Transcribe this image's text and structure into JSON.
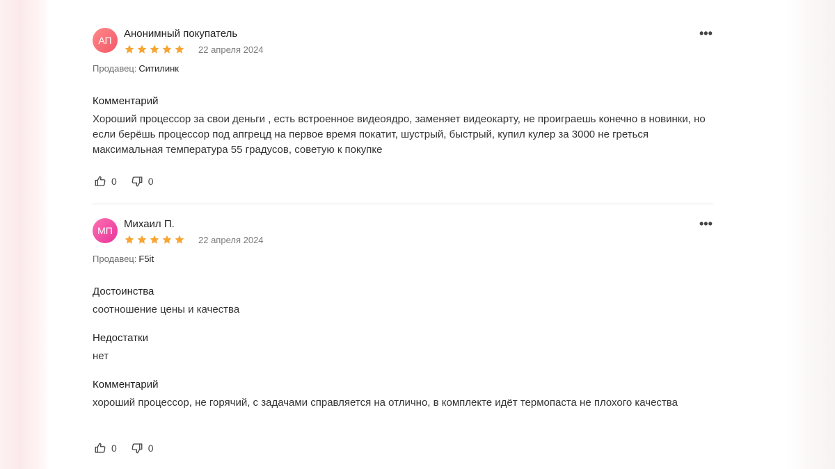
{
  "colors": {
    "star": "#f7a533",
    "avatar_1": "#f25767",
    "avatar_2": "#e6359a",
    "muted_text": "#7a7a7a"
  },
  "icons": {
    "rating_star": "star-icon",
    "more": "more-dots-icon",
    "like": "thumbs-up-icon",
    "dislike": "thumbs-down-icon"
  },
  "reviews": [
    {
      "avatar_initials": "АП",
      "author": "Анонимный покупатель",
      "rating": 5,
      "rating_max": 5,
      "date": "22 апреля 2024",
      "more_label": "•••",
      "seller_label": "Продавец:",
      "seller": "Ситилинк",
      "comment_title": "Комментарий",
      "comment": "Хороший процессор за свои деньги , есть встроенное видеоядро, заменяет видеокарту, не проиграешь конечно в новинки, но если берёшь процессор под апгрецд на первое время покатит, шустрый, быстрый, купил кулер за 3000 не греться максимальная температура 55 градусов, советую к покупке",
      "likes": "0",
      "dislikes": "0"
    },
    {
      "avatar_initials": "МП",
      "author": "Михаил П.",
      "rating": 5,
      "rating_max": 5,
      "date": "22 апреля 2024",
      "more_label": "•••",
      "seller_label": "Продавец:",
      "seller": "F5it",
      "pros_title": "Достоинства",
      "pros": "соотношение цены и качества",
      "cons_title": "Недостатки",
      "cons": "нет",
      "comment_title": "Комментарий",
      "comment": "хороший процессор, не горячий, с задачами справляется на отлично, в комплекте идёт термопаста не плохого качества",
      "likes": "0",
      "dislikes": "0"
    }
  ]
}
